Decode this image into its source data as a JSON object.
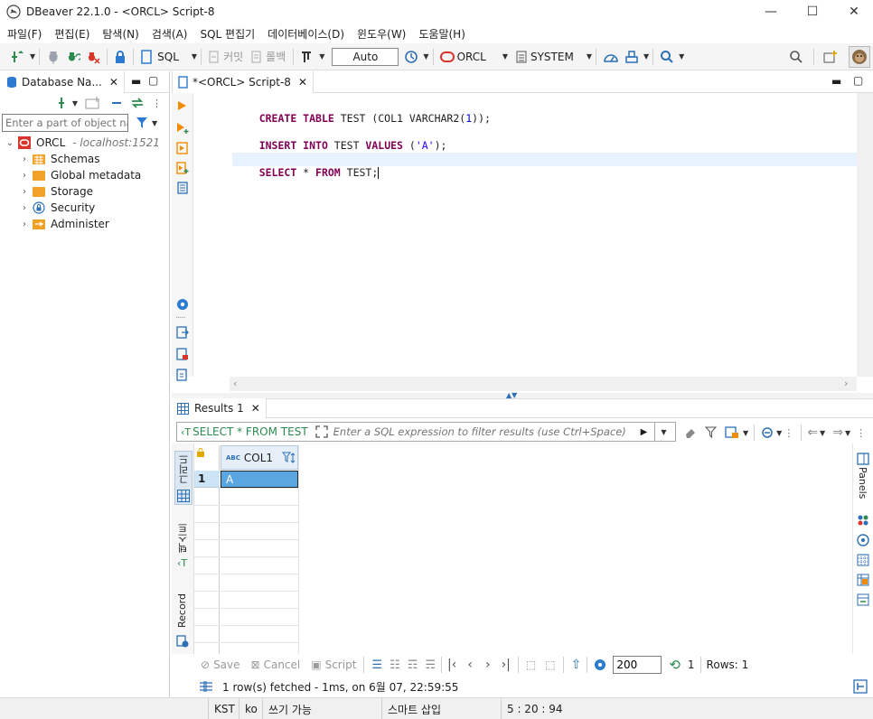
{
  "window": {
    "title": "DBeaver 22.1.0 - <ORCL> Script-8",
    "minimize": "—",
    "maximize": "☐",
    "close": "✕"
  },
  "menu": [
    "파일(F)",
    "편집(E)",
    "탐색(N)",
    "검색(A)",
    "SQL 편집기",
    "데이터베이스(D)",
    "윈도우(W)",
    "도움말(H)"
  ],
  "toolbar": {
    "sql_label": "SQL",
    "commit_label": "커밋",
    "rollback_label": "롤백",
    "transaction_mode": "Auto",
    "datasource": "ORCL",
    "schema": "SYSTEM"
  },
  "navigator": {
    "tab_label": "Database Na...",
    "filter_placeholder": "Enter a part of object name",
    "connection": {
      "name": "ORCL",
      "host": "- localhost:1521"
    },
    "items": [
      "Schemas",
      "Global metadata",
      "Storage",
      "Security",
      "Administer"
    ]
  },
  "editor": {
    "tab_label": "*<ORCL> Script-8",
    "lines": [
      {
        "kw1": "CREATE TABLE",
        "t1": " TEST (COL1 VARCHAR2(",
        "n": "1",
        "t2": "));"
      },
      {
        "kw1": "INSERT INTO",
        "t1": " TEST ",
        "kw2": "VALUES",
        "t2": " (",
        "s": "'A'",
        "t3": ");"
      },
      {
        "kw1": "SELECT",
        "t1": " * ",
        "kw2": "FROM",
        "t2": " TEST;"
      }
    ]
  },
  "results": {
    "tab_label": "Results 1",
    "query_label": "SELECT * FROM TEST",
    "filter_placeholder": "Enter a SQL expression to filter results (use Ctrl+Space)",
    "column": "COL1",
    "column_type": "ABC",
    "rows": [
      {
        "num": "1",
        "value": "A"
      }
    ],
    "side_tabs": {
      "grid": "그리드",
      "text": "텍스트",
      "record": "Record"
    },
    "panels_label": "Panels",
    "bottom": {
      "save": "Save",
      "cancel": "Cancel",
      "script": "Script",
      "fetch_size": "200",
      "refresh_count": "1",
      "rows_info": "Rows: 1"
    },
    "status": "1 row(s) fetched - 1ms, on 6월 07, 22:59:55"
  },
  "statusbar": {
    "timezone": "KST",
    "locale": "ko",
    "mode": "쓰기 가능",
    "insert_mode": "스마트 삽입",
    "position": "5 : 20 : 94"
  },
  "colors": {
    "accent": "#1f6fbf",
    "selection": "#cce4f7",
    "keyword": "#7f0055",
    "string": "#2a00ff",
    "orange": "#f08c00"
  }
}
